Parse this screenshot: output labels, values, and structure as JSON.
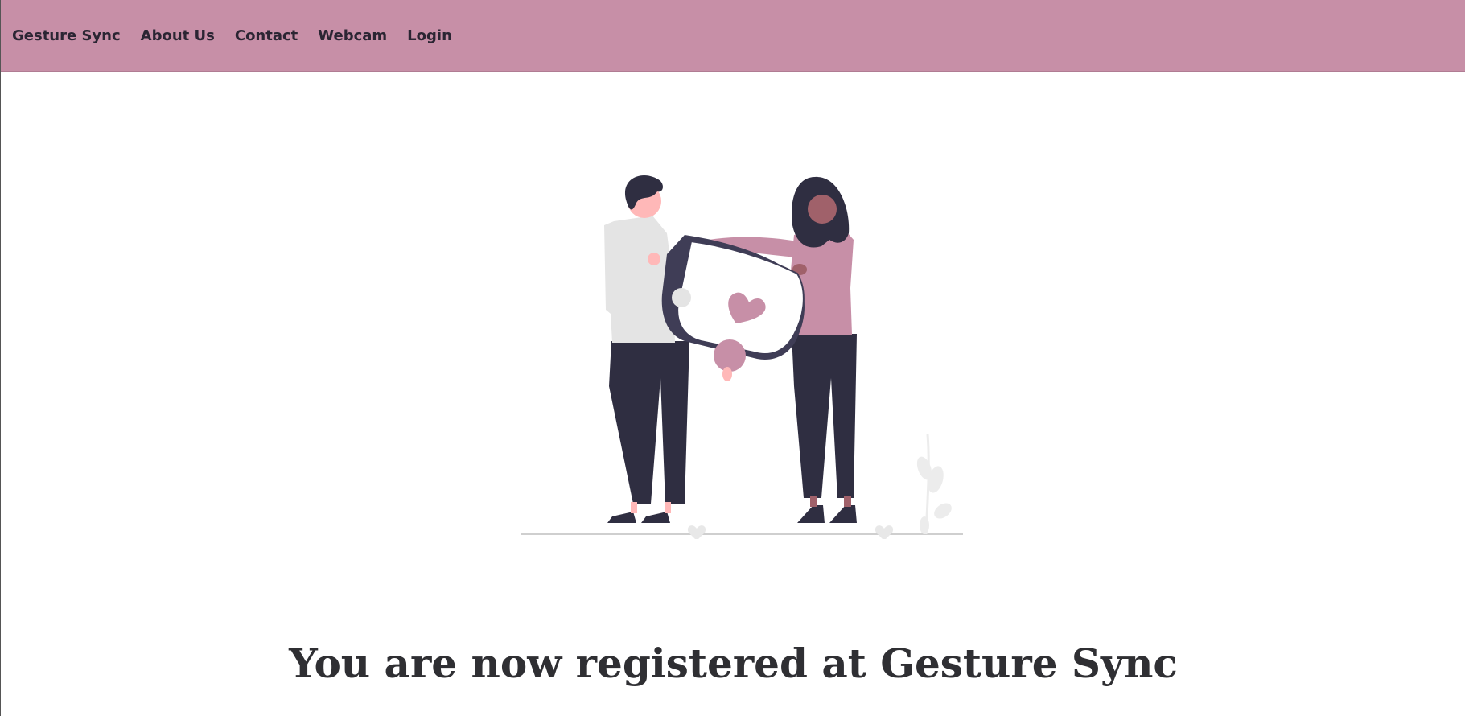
{
  "nav": {
    "brand": "Gesture Sync",
    "links": [
      "About Us",
      "Contact",
      "Webcam",
      "Login"
    ]
  },
  "main": {
    "headline": "You are now registered at Gesture Sync",
    "illustration": "two-people-holding-heart-puzzle"
  },
  "colors": {
    "navbar_bg": "#c78fa7",
    "accent_pink": "#c78fa7",
    "dark": "#2f2e41",
    "text": "#2f2f33"
  }
}
